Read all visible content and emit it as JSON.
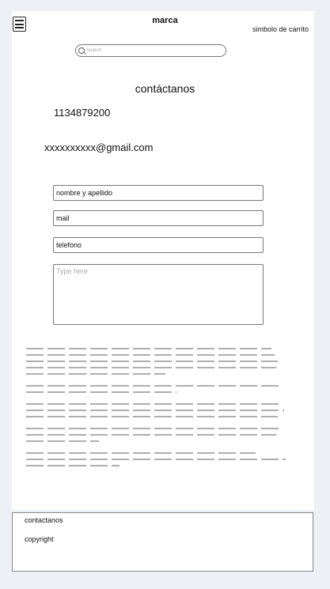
{
  "header": {
    "brand": "marca",
    "cart_label": "simbolo de carrito"
  },
  "search": {
    "placeholder": "Search"
  },
  "contact": {
    "title": "contáctanos",
    "phone": "1134879200",
    "email": "xxxxxxxxxx@gmail.com"
  },
  "form": {
    "name_value": "nombre y apellido",
    "mail_value": "mail",
    "phone_value": "telefono",
    "message_placeholder": "Type here"
  },
  "footer": {
    "contact_label": "contactanos",
    "copyright_label": "copyright"
  }
}
